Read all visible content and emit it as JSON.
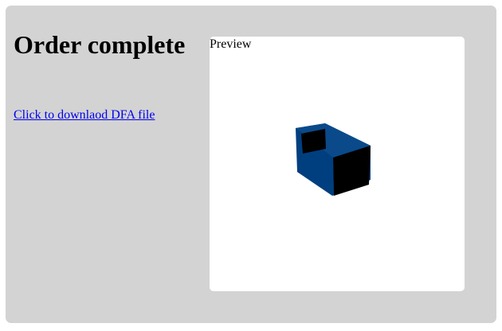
{
  "page": {
    "title": "Order complete",
    "download_link": "Click to downlaod DFA file"
  },
  "preview": {
    "label": "Preview",
    "model_color": "#003f7f",
    "model_shade_color": "#000000"
  }
}
